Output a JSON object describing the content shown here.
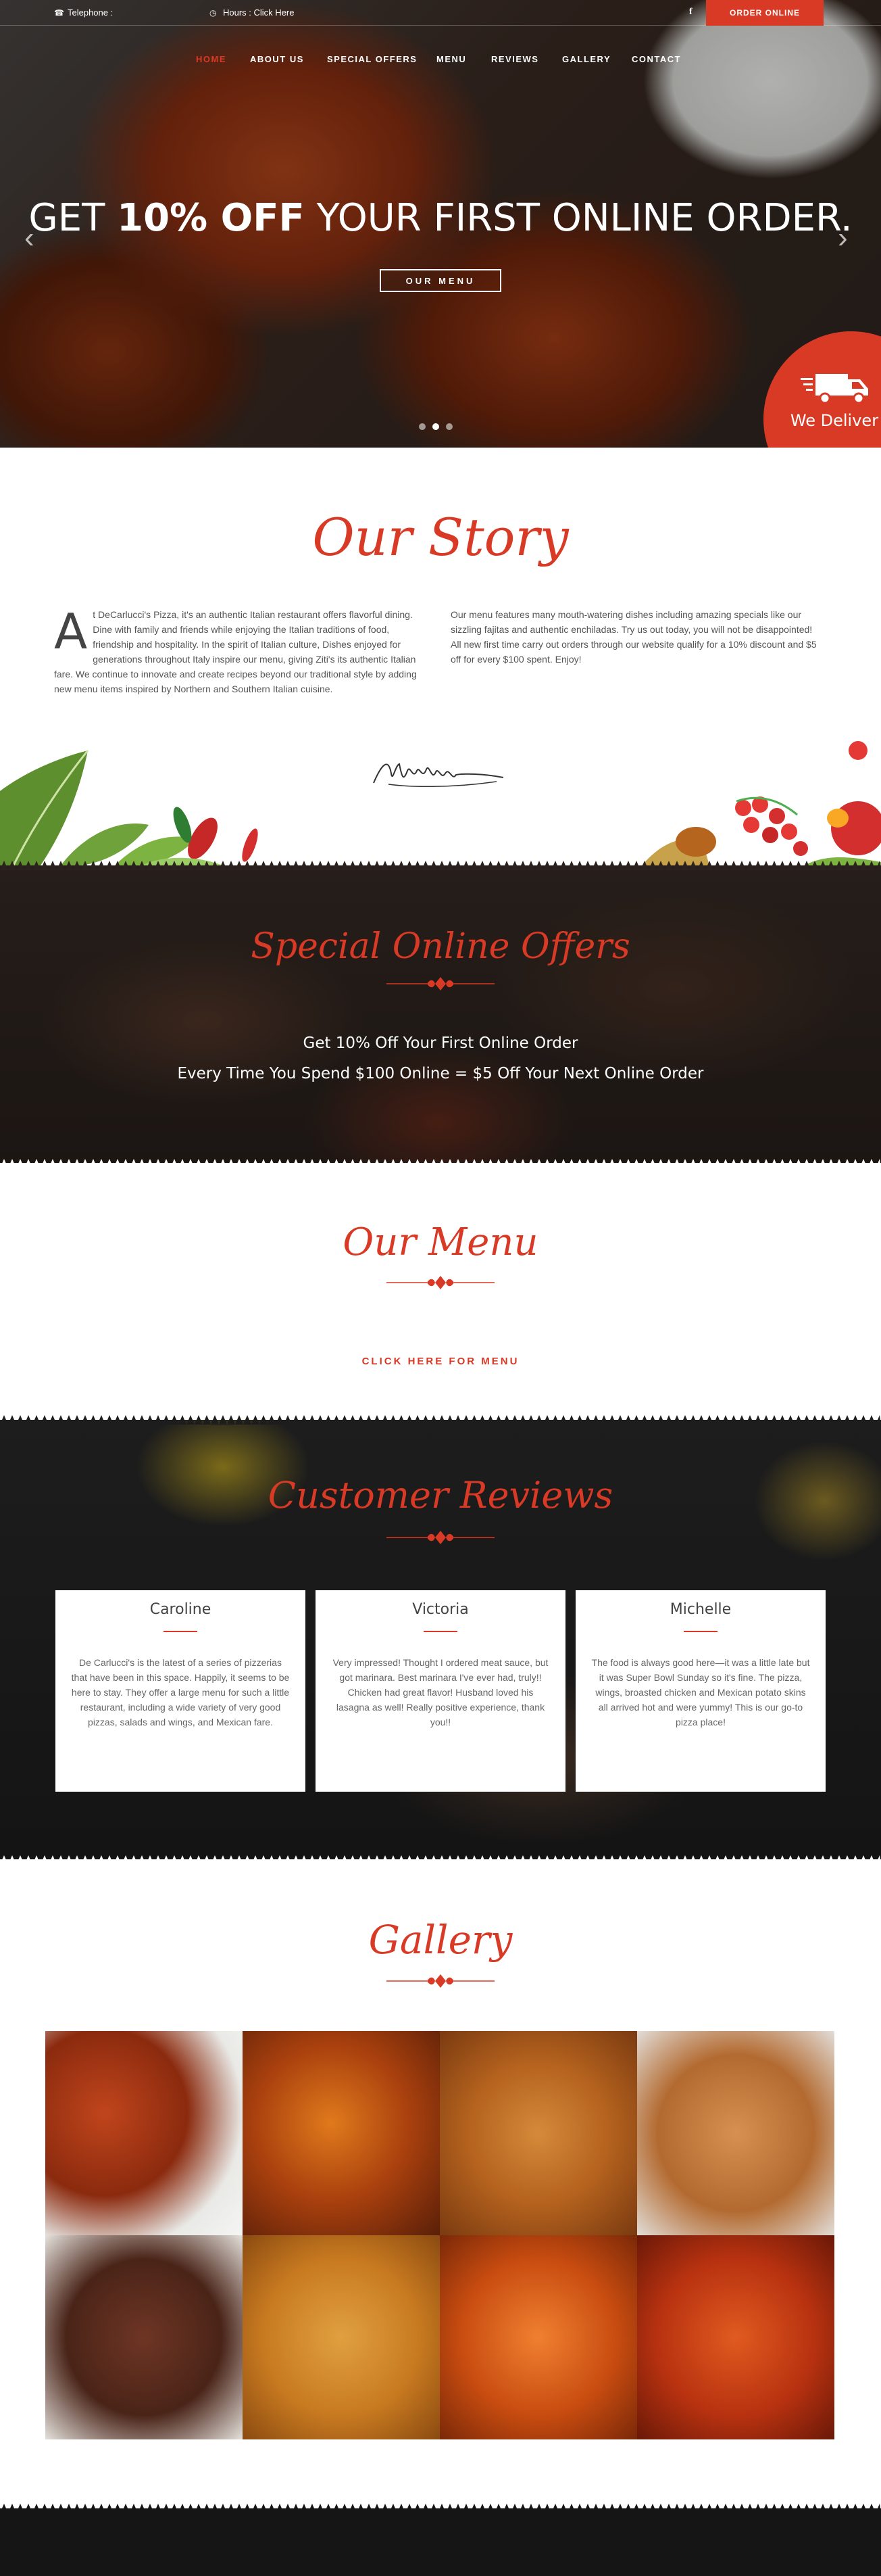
{
  "topbar": {
    "telephone_label": "Telephone :",
    "hours_label": "Hours : Click Here",
    "order_online": "ORDER ONLINE",
    "facebook_glyph": "f"
  },
  "nav": {
    "items": [
      "HOME",
      "ABOUT US",
      "SPECIAL OFFERS",
      "MENU",
      "REVIEWS",
      "GALLERY",
      "CONTACT"
    ]
  },
  "hero": {
    "title_prefix": "GET ",
    "title_bold": "10% OFF",
    "title_suffix": " YOUR FIRST ONLINE ORDER.",
    "button": "OUR MENU",
    "deliver_text": "We Deliver",
    "slide_count": 3,
    "active_slide": 2
  },
  "story": {
    "title": "Our Story",
    "drop_cap": "A",
    "left_text": "t DeCarlucci's Pizza, it's an authentic Italian restaurant offers flavorful dining. Dine with family and friends while enjoying the Italian traditions of food, friendship and hospitality. In the spirit of Italian culture, Dishes enjoyed for generations throughout Italy inspire our menu, giving Ziti's its authentic Italian fare. We continue to innovate and create recipes beyond our traditional style by adding new menu items inspired by Northern and Southern Italian cuisine.",
    "right_text": "Our menu features many mouth-watering dishes including amazing specials like our sizzling fajitas and authentic enchiladas. Try us out today, you will not be disappointed! All new first time carry out orders through our website qualify for a 10% discount and $5 off for every $100 spent. Enjoy!"
  },
  "offers": {
    "title": "Special Online Offers",
    "line1": "Get 10% Off Your First Online Order",
    "line2": "Every Time You Spend $100 Online = $5 Off Your Next Online Order"
  },
  "menu": {
    "title": "Our Menu",
    "link": "CLICK HERE FOR MENU"
  },
  "reviews": {
    "title": "Customer Reviews",
    "cards": [
      {
        "name": "Caroline",
        "text": "De Carlucci's is the latest of a series of pizzerias that have been in this space. Happily, it seems to be here to stay. They offer a large menu for such a little restaurant, including a wide variety of very good pizzas, salads and wings, and Mexican fare."
      },
      {
        "name": "Victoria",
        "text": "Very impressed! Thought I ordered meat sauce, but got marinara. Best marinara I've ever had, truly!! Chicken had great flavor! Husband loved his lasagna as well! Really positive experience, thank you!!"
      },
      {
        "name": "Michelle",
        "text": "The food is always good here—it was a little late but it was Super Bowl Sunday so it's fine. The pizza, wings, broasted chicken and Mexican potato skins all arrived hot and were yummy! This is our go-to pizza place!"
      }
    ]
  },
  "gallery": {
    "title": "Gallery",
    "images": [
      "wings-with-ranch",
      "glazed-wing-closeup",
      "breaded-wings",
      "honey-garlic-wings",
      "bbq-wings",
      "crispy-buffalo-wings",
      "hot-wings",
      "buffalo-wings-pile"
    ]
  },
  "colors": {
    "accent": "#d93a25",
    "dark": "#151515"
  }
}
